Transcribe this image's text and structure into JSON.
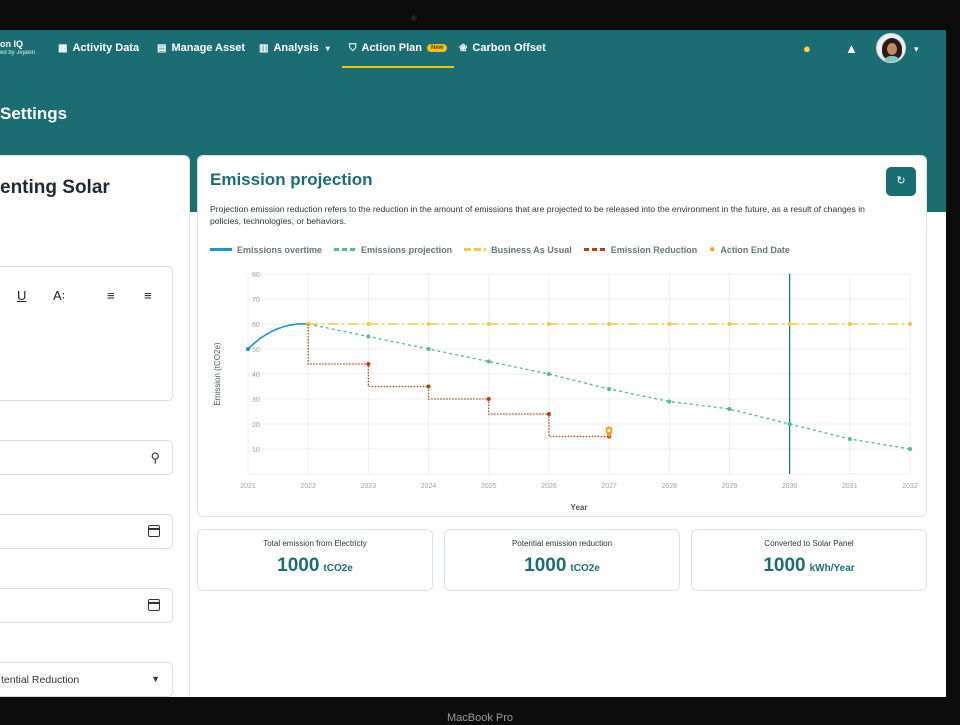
{
  "nav": {
    "brand_title": "on IQ",
    "brand_sub": "ed by Jejakin",
    "items": [
      {
        "label": "Activity Data",
        "icon": "grid-icon"
      },
      {
        "label": "Manage Asset",
        "icon": "document-icon"
      },
      {
        "label": "Analysis",
        "icon": "bar-chart-icon"
      },
      {
        "label": "Action Plan",
        "icon": "trophy-icon",
        "badge": "New"
      },
      {
        "label": "Carbon Offset",
        "icon": "leaf-icon"
      }
    ],
    "active": "Action Plan"
  },
  "page": {
    "title": "Settings",
    "left_title": "enting Solar",
    "dropdown_value": "tential Reduction"
  },
  "card": {
    "title": "Emission projection",
    "description": "Projection emission reduction refers to the reduction in the amount of emissions that are projected to be released into the environment in the future, as a result of changes in policies, technologies, or behaviors.",
    "legend": [
      {
        "label": "Emissions overtime",
        "color": "#1e95c4",
        "style": "solid"
      },
      {
        "label": "Emissions projection",
        "color": "#52bc8e",
        "style": "dashed"
      },
      {
        "label": "Business As Usual",
        "color": "#f4c93b",
        "style": "dashed"
      },
      {
        "label": "Emission Reduction",
        "color": "#b7410e",
        "style": "dashed"
      },
      {
        "label": "Action End Date",
        "color": "#f2a21b",
        "style": "marker"
      }
    ]
  },
  "chart_data": {
    "type": "line",
    "title": "",
    "xlabel": "Year",
    "ylabel": "Emission (tCO2e)",
    "x_ticks": [
      "2021",
      "2022",
      "2023",
      "2024",
      "2025",
      "2026",
      "2027",
      "2028",
      "2029",
      "2030",
      "2031",
      "2032"
    ],
    "y_ticks": [
      10,
      20,
      30,
      40,
      50,
      60,
      70,
      80
    ],
    "ylim": [
      0,
      80
    ],
    "xlim": [
      2021,
      2032
    ],
    "series": [
      {
        "name": "Emissions overtime",
        "style": "solid",
        "color": "#1e95c4",
        "x": [
          2021,
          2022
        ],
        "y": [
          50,
          60
        ]
      },
      {
        "name": "Emissions projection",
        "style": "dashed",
        "color": "#52bc8e",
        "x": [
          2022,
          2023,
          2024,
          2025,
          2026,
          2027,
          2028,
          2029,
          2030,
          2031,
          2032
        ],
        "y": [
          60,
          55,
          50,
          45,
          40,
          34,
          29,
          26,
          20,
          14,
          10
        ]
      },
      {
        "name": "Business As Usual",
        "style": "dashdot",
        "color": "#f4c93b",
        "x": [
          2022,
          2023,
          2024,
          2025,
          2026,
          2027,
          2028,
          2029,
          2030,
          2031,
          2032
        ],
        "y": [
          60,
          60,
          60,
          60,
          60,
          60,
          60,
          60,
          60,
          60,
          60
        ]
      },
      {
        "name": "Emission Reduction",
        "style": "step-dotted",
        "color": "#b7410e",
        "x": [
          2022,
          2023,
          2024,
          2025,
          2026,
          2027
        ],
        "y": [
          44,
          35,
          30,
          24,
          15,
          15
        ]
      }
    ],
    "action_end": {
      "x": 2027,
      "y": 17
    },
    "vertical_marker_x": 2030,
    "grid": true
  },
  "stats": [
    {
      "label": "Total emission from Electricty",
      "value": "1000",
      "unit": "tCO2e"
    },
    {
      "label": "Potential emission reduction",
      "value": "1000",
      "unit": "tCO2e"
    },
    {
      "label": "Converted to Solar Panel",
      "value": "1000",
      "unit": "kWh/Year"
    }
  ],
  "device": {
    "label": "MacBook Pro"
  }
}
